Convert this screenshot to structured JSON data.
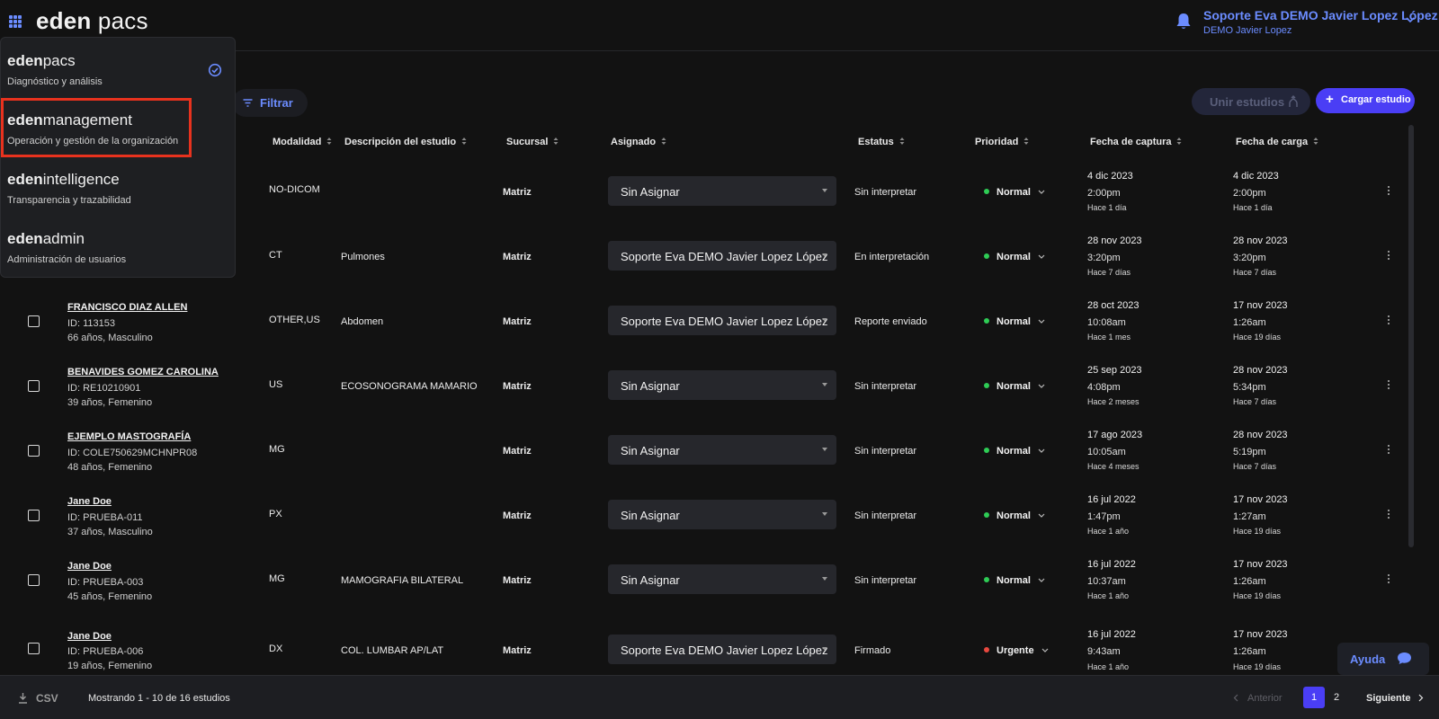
{
  "header": {
    "logo_bold": "eden",
    "logo_light": "pacs",
    "user_name": "Soporte Eva DEMO Javier Lopez López",
    "user_sub": "DEMO Javier Lopez"
  },
  "app_menu": {
    "items": [
      {
        "bold": "eden",
        "light": "pacs",
        "desc": "Diagnóstico y análisis",
        "selected": true
      },
      {
        "bold": "eden",
        "light": "management",
        "desc": "Operación y gestión de la organización",
        "selected": false
      },
      {
        "bold": "eden",
        "light": "intelligence",
        "desc": "Transparencia y trazabilidad",
        "selected": false
      },
      {
        "bold": "eden",
        "light": "admin",
        "desc": "Administración de usuarios",
        "selected": false
      }
    ]
  },
  "toolbar": {
    "filter_label": "Filtrar",
    "merge_label": "Unir estudios",
    "upload_label": "Cargar estudio"
  },
  "table": {
    "headers": {
      "modality": "Modalidad",
      "description": "Descripción del estudio",
      "branch": "Sucursal",
      "assigned": "Asignado",
      "status": "Estatus",
      "priority": "Prioridad",
      "capture_date": "Fecha de captura",
      "upload_date": "Fecha de carga"
    },
    "rows": [
      {
        "name": "",
        "id": "",
        "age": "",
        "modality": "NO-DICOM",
        "description": "",
        "branch": "Matriz",
        "assigned": "Sin Asignar",
        "status": "Sin interpretar",
        "priority": "Normal",
        "capture_date": "4 dic 2023",
        "capture_time": "2:00pm",
        "capture_ago": "Hace 1 día",
        "upload_date": "4 dic 2023",
        "upload_time": "2:00pm",
        "upload_ago": "Hace 1 día"
      },
      {
        "name": "",
        "id": "",
        "age": "",
        "modality": "CT",
        "description": "Pulmones",
        "branch": "Matriz",
        "assigned": "Soporte Eva DEMO Javier Lopez López",
        "status": "En interpretación",
        "priority": "Normal",
        "capture_date": "28 nov 2023",
        "capture_time": "3:20pm",
        "capture_ago": "Hace 7 días",
        "upload_date": "28 nov 2023",
        "upload_time": "3:20pm",
        "upload_ago": "Hace 7 días"
      },
      {
        "name": "FRANCISCO DIAZ ALLEN",
        "id": "ID: 113153",
        "age": "66 años, Masculino",
        "modality": "OTHER,US",
        "description": "Abdomen",
        "branch": "Matriz",
        "assigned": "Soporte Eva DEMO Javier Lopez López",
        "status": "Reporte enviado",
        "priority": "Normal",
        "capture_date": "28 oct 2023",
        "capture_time": "10:08am",
        "capture_ago": "Hace 1 mes",
        "upload_date": "17 nov 2023",
        "upload_time": "1:26am",
        "upload_ago": "Hace 19 días"
      },
      {
        "name": "BENAVIDES GOMEZ CAROLINA",
        "id": "ID: RE10210901",
        "age": "39 años, Femenino",
        "modality": "US",
        "description": "ECOSONOGRAMA MAMARIO",
        "branch": "Matriz",
        "assigned": "Sin Asignar",
        "status": "Sin interpretar",
        "priority": "Normal",
        "capture_date": "25 sep 2023",
        "capture_time": "4:08pm",
        "capture_ago": "Hace 2 meses",
        "upload_date": "28 nov 2023",
        "upload_time": "5:34pm",
        "upload_ago": "Hace 7 días"
      },
      {
        "name": "EJEMPLO MASTOGRAFÍA",
        "id": "ID: COLE750629MCHNPR08",
        "age": "48 años, Femenino",
        "modality": "MG",
        "description": "",
        "branch": "Matriz",
        "assigned": "Sin Asignar",
        "status": "Sin interpretar",
        "priority": "Normal",
        "capture_date": "17 ago 2023",
        "capture_time": "10:05am",
        "capture_ago": "Hace 4 meses",
        "upload_date": "28 nov 2023",
        "upload_time": "5:19pm",
        "upload_ago": "Hace 7 días"
      },
      {
        "name": "Jane Doe",
        "id": "ID: PRUEBA-011",
        "age": "37 años, Masculino",
        "modality": "PX",
        "description": "",
        "branch": "Matriz",
        "assigned": "Sin Asignar",
        "status": "Sin interpretar",
        "priority": "Normal",
        "capture_date": "16 jul 2022",
        "capture_time": "1:47pm",
        "capture_ago": "Hace 1 año",
        "upload_date": "17 nov 2023",
        "upload_time": "1:27am",
        "upload_ago": "Hace 19 días"
      },
      {
        "name": "Jane Doe",
        "id": "ID: PRUEBA-003",
        "age": "45 años, Femenino",
        "modality": "MG",
        "description": "MAMOGRAFIA BILATERAL",
        "branch": "Matriz",
        "assigned": "Sin Asignar",
        "status": "Sin interpretar",
        "priority": "Normal",
        "capture_date": "16 jul 2022",
        "capture_time": "10:37am",
        "capture_ago": "Hace 1 año",
        "upload_date": "17 nov 2023",
        "upload_time": "1:26am",
        "upload_ago": "Hace 19 días"
      },
      {
        "name": "Jane Doe",
        "id": "ID: PRUEBA-006",
        "age": "19 años, Femenino",
        "modality": "DX",
        "description": "COL. LUMBAR AP/LAT",
        "branch": "Matriz",
        "assigned": "Soporte Eva DEMO Javier Lopez López",
        "status": "Firmado",
        "priority": "Urgente",
        "capture_date": "16 jul 2022",
        "capture_time": "9:43am",
        "capture_ago": "Hace 1 año",
        "upload_date": "17 nov 2023",
        "upload_time": "1:26am",
        "upload_ago": "Hace 19 días"
      }
    ]
  },
  "footer": {
    "csv_label": "CSV",
    "showing": "Mostrando 1 - 10 de 16 estudios",
    "prev_label": "Anterior",
    "pages": [
      "1",
      "2"
    ],
    "current_page": "1",
    "next_label": "Siguiente"
  },
  "help": {
    "label": "Ayuda"
  },
  "colors": {
    "accent": "#6b8cff",
    "primary": "#4a3ef5",
    "priority_normal": "#2ecc55",
    "priority_urgent": "#e8483f",
    "highlight": "#e8321e"
  }
}
